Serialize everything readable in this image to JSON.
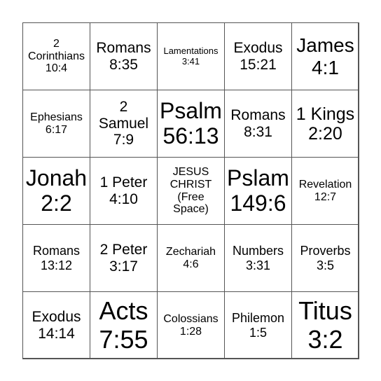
{
  "cells": [
    [
      "2",
      "Corinthians",
      "10:4"
    ],
    [
      "Romans",
      "8:35"
    ],
    [
      "Lamentations",
      "3:41"
    ],
    [
      "Exodus",
      "15:21"
    ],
    [
      "James",
      "4:1"
    ],
    [
      "Ephesians",
      "6:17"
    ],
    [
      "2",
      "Samuel",
      "7:9"
    ],
    [
      "Psalm",
      "56:13"
    ],
    [
      "Romans",
      "8:31"
    ],
    [
      "1 Kings",
      "2:20"
    ],
    [
      "Jonah",
      "2:2"
    ],
    [
      "1 Peter",
      "4:10"
    ],
    [
      "JESUS",
      "CHRIST",
      "(Free",
      "Space)"
    ],
    [
      "Pslam",
      "149:6"
    ],
    [
      "Revelation",
      "12:7"
    ],
    [
      "Romans",
      "13:12"
    ],
    [
      "2 Peter",
      "3:17"
    ],
    [
      "Zechariah",
      "4:6"
    ],
    [
      "Numbers",
      "3:31"
    ],
    [
      "Proverbs",
      "3:5"
    ],
    [
      "Exodus",
      "14:14"
    ],
    [
      "Acts",
      "7:55"
    ],
    [
      "Colossians",
      "1:28"
    ],
    [
      "Philemon",
      "1:5"
    ],
    [
      "Titus",
      "3:2"
    ]
  ]
}
